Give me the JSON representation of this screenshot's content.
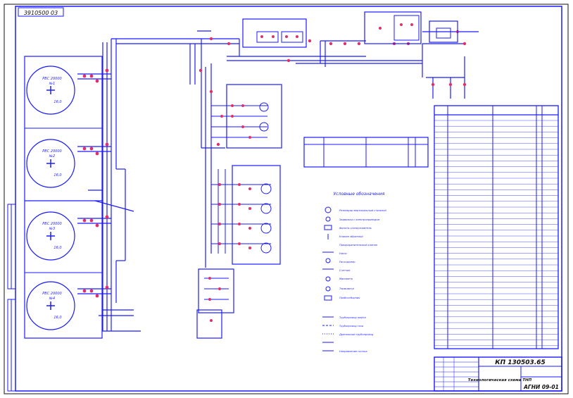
{
  "drawing": {
    "code_stamp": "3910500 03",
    "title_code": "КП 130503.65",
    "title_name": "Технологическая схема ТНП",
    "sheet_code": "АГНИ 09-01",
    "legend_title": "Условные обозначения"
  },
  "tanks": [
    {
      "label": "РВС 20000",
      "num": "№1",
      "level": "16,0"
    },
    {
      "label": "РВС 20000",
      "num": "№2",
      "level": "16,0"
    },
    {
      "label": "РВС 20000",
      "num": "№3",
      "level": "16,0"
    },
    {
      "label": "РВС 20000",
      "num": "№4",
      "level": "16,0"
    }
  ],
  "legend": [
    "Резервуар вертикальный стальной",
    "Задвижка с электроприводом",
    "Фильтр-грязеуловитель",
    "Клапан обратный",
    "Предохранительный клапан",
    "Насос",
    "Расходомер",
    "Счетчик",
    "Манометр",
    "Термометр",
    "Пробоотборник",
    "Трубопровод нефти",
    "Трубопровод газа",
    "Дренажный трубопровод",
    "Направление потока"
  ],
  "colors": {
    "line": "#1a1aff",
    "accent": "#e0306a",
    "ink": "#111111"
  }
}
